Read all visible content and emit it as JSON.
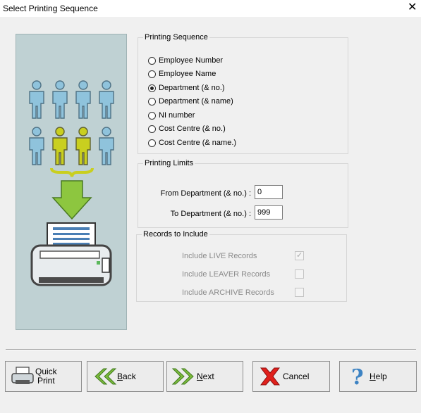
{
  "window": {
    "title": "Select Printing Sequence",
    "close_glyph": "✕"
  },
  "printing_sequence": {
    "legend": "Printing Sequence",
    "selected_index": 2,
    "options": [
      "Employee Number",
      "Employee Name",
      "Department (& no.)",
      "Department (& name)",
      "NI number",
      "Cost Centre (& no.)",
      "Cost Centre (& name.)"
    ]
  },
  "printing_limits": {
    "legend": "Printing Limits",
    "from_label": "From Department (& no.) :",
    "from_value": "0",
    "to_label": "To Department (& no.) :",
    "to_value": "999"
  },
  "records": {
    "legend": "Records to Include",
    "live_label": "Include LIVE Records",
    "live_checked": true,
    "leaver_label": "Include LEAVER Records",
    "leaver_checked": false,
    "archive_label": "Include ARCHIVE Records",
    "archive_checked": false
  },
  "buttons": {
    "quick_print_line1": "Quick",
    "quick_print_line2": "Print",
    "back_first": "B",
    "back_rest": "ack",
    "next_first": "N",
    "next_rest": "ext",
    "cancel": "Cancel",
    "help_first": "H",
    "help_rest": "elp"
  },
  "colors": {
    "art_bg": "#bfd1d3",
    "person_blue": "#8fc3dc",
    "person_yellow": "#c9cf1f",
    "arrow_green": "#8dc63f",
    "cancel_red": "#e0201c",
    "help_blue": "#3d83c3"
  },
  "icons": {
    "illustration": "employees-to-printer-illustration",
    "quick_print": "printer-icon",
    "back": "double-chevron-left-icon",
    "next": "double-chevron-right-icon",
    "cancel": "red-x-icon",
    "help": "question-mark-icon"
  }
}
